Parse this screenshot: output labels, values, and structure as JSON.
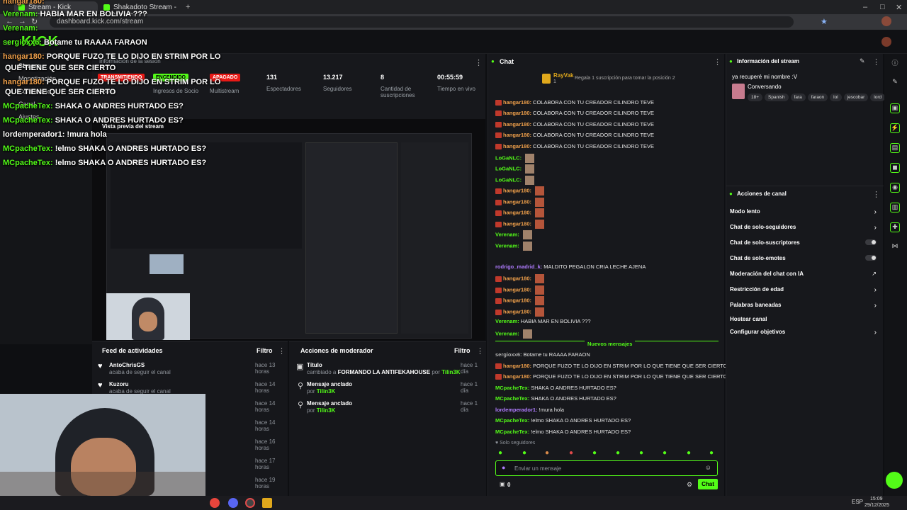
{
  "browser": {
    "tabs": [
      "Stream - Kick Dashboard",
      "Shakadoto Stream - Watch Live"
    ],
    "url": "dashboard.kick.com/stream",
    "clock": "15:09",
    "date": "29/12/2025",
    "lang": "ESP"
  },
  "header": {
    "logo": "KICK"
  },
  "leftnav": {
    "items": [
      "Stream",
      "Monetización",
      "Comunidad",
      "Canal",
      "Ajustes"
    ],
    "info_label": "Información de la sesión"
  },
  "stats": {
    "status_pill": "TRANSMITIENDO",
    "status_label": "Estado",
    "socio_pill": "ENCENDIDO",
    "socio_label": "Ingresos de Socio",
    "multistream_pill": "APAGADO",
    "multistream_label": "Multistream",
    "viewers": "131",
    "viewers_label": "Espectadores",
    "followers": "13.217",
    "followers_label": "Seguidores",
    "subs": "8",
    "subs_label": "Cantidad de suscripciones",
    "uptime": "00:55:59",
    "uptime_label": "Tiempo en vivo"
  },
  "preview": {
    "label": "Vista previa del stream"
  },
  "overlay_chat": [
    {
      "user": "hangar180:",
      "text": "",
      "color": "#f0a04b"
    },
    {
      "user": "Verenam:",
      "text": "HABIA MAR EN BOLIVIA ???",
      "color": "#53fc18"
    },
    {
      "user": "Verenam:",
      "text": "",
      "color": "#53fc18"
    },
    {
      "user": "sergioxx6:",
      "text": "Botame tu RAAAA FARAON",
      "color": "#53fc18"
    },
    {
      "user": "hangar180:",
      "text": "PORQUE FUZO TE LO DIJO EN STRIM POR LO",
      "color": "#f0a04b"
    },
    {
      "user": "",
      "text": "QUE TIENE QUE SER CIERTO",
      "color": "#fff"
    },
    {
      "user": "hangar180:",
      "text": "PORQUE FUZO TE LO DIJO EN STRIM POR LO",
      "color": "#f0a04b"
    },
    {
      "user": "",
      "text": "QUE TIENE QUE SER CIERTO",
      "color": "#fff"
    },
    {
      "user": "MCpacheTex:",
      "text": "SHAKA O ANDRES HURTADO ES?",
      "color": "#53fc18"
    },
    {
      "user": "MCpacheTex:",
      "text": "SHAKA O ANDRES HURTADO ES?",
      "color": "#53fc18"
    },
    {
      "user": "lordemperador1:",
      "text": "!mura hola",
      "color": "#fff"
    },
    {
      "user": "MCpacheTex:",
      "text": "!elmo SHAKA O ANDRES HURTADO ES?",
      "color": "#53fc18"
    },
    {
      "user": "MCpacheTex:",
      "text": "!elmo SHAKA O ANDRES HURTADO ES?",
      "color": "#53fc18"
    }
  ],
  "activity": {
    "title": "Feed de actividades",
    "filter": "Filtro",
    "items": [
      {
        "user": "AntoChrisGS",
        "action": "acaba de seguir el canal",
        "time": "hace 13 horas"
      },
      {
        "user": "Kuzoru",
        "action": "acaba de seguir el canal",
        "time": "hace 14 horas"
      },
      {
        "user": "",
        "action": "",
        "time": "hace 14 horas"
      },
      {
        "user": "",
        "action": "",
        "time": "hace 14 horas"
      },
      {
        "user": "",
        "action": "",
        "time": "hace 16 horas"
      },
      {
        "user": "",
        "action": "",
        "time": "hace 17 horas"
      },
      {
        "user": "",
        "action": "",
        "time": "hace 19 horas"
      }
    ]
  },
  "modactions": {
    "title": "Acciones de moderador",
    "filter": "Filtro",
    "items": [
      {
        "title": "Título",
        "prefix": "cambiado a",
        "detail": "FORMANDO LA ANTIFEKAHOUSE",
        "by": "por",
        "mod": "Tilin3K",
        "time": "hace 1 día"
      },
      {
        "title": "Mensaje anclado",
        "prefix": "",
        "detail": "",
        "by": "por",
        "mod": "Tilin3K",
        "time": "hace 1 día"
      },
      {
        "title": "Mensaje anclado",
        "prefix": "",
        "detail": "",
        "by": "por",
        "mod": "Tilin3K",
        "time": "hace 1 día"
      }
    ]
  },
  "chat": {
    "title": "Chat",
    "gifter": "RayVak",
    "gifter_count": "1",
    "gift_prompt": "Regala 1 suscripción para tomar la posición 2",
    "messages": [
      {
        "user": "hangar180:",
        "text": "COLABORA CON TU CREADOR CILINDRO TEVE",
        "color": "#f0a04b"
      },
      {
        "user": "hangar180:",
        "text": "COLABORA CON TU CREADOR CILINDRO TEVE",
        "color": "#f0a04b"
      },
      {
        "user": "hangar180:",
        "text": "COLABORA CON TU CREADOR CILINDRO TEVE",
        "color": "#f0a04b"
      },
      {
        "user": "hangar180:",
        "text": "COLABORA CON TU CREADOR CILINDRO TEVE",
        "color": "#f0a04b"
      },
      {
        "user": "hangar180:",
        "text": "COLABORA CON TU CREADOR CILINDRO TEVE",
        "color": "#f0a04b"
      },
      {
        "user": "LoGaNLC:",
        "text": "",
        "color": "#53fc18"
      },
      {
        "user": "LoGaNLC:",
        "text": "",
        "color": "#53fc18"
      },
      {
        "user": "LoGaNLC:",
        "text": "",
        "color": "#53fc18"
      },
      {
        "user": "hangar180:",
        "text": "",
        "color": "#f0a04b"
      },
      {
        "user": "hangar180:",
        "text": "",
        "color": "#f0a04b"
      },
      {
        "user": "hangar180:",
        "text": "",
        "color": "#f0a04b"
      },
      {
        "user": "hangar180:",
        "text": "",
        "color": "#f0a04b"
      },
      {
        "user": "Verenam:",
        "text": "",
        "color": "#53fc18"
      },
      {
        "user": "Verenam:",
        "text": "",
        "color": "#53fc18"
      },
      {
        "user": "rodrigo_madrid_k:",
        "text": "MALDITO PEGALON CRIA LECHE AJENA",
        "color": "#b07cff"
      },
      {
        "user": "hangar180:",
        "text": "",
        "color": "#f0a04b"
      },
      {
        "user": "hangar180:",
        "text": "",
        "color": "#f0a04b"
      },
      {
        "user": "hangar180:",
        "text": "",
        "color": "#f0a04b"
      },
      {
        "user": "hangar180:",
        "text": "",
        "color": "#f0a04b"
      },
      {
        "user": "Verenam:",
        "text": "HABIA MAR EN BOLIVIA ???",
        "color": "#53fc18"
      },
      {
        "user": "Verenam:",
        "text": "",
        "color": "#53fc18"
      }
    ],
    "new_messages_label": "Nuevos mensajes",
    "new_messages": [
      {
        "user": "sergioxx6:",
        "text": "Botame tu RAAAA FARAON",
        "color": "#b0b0b0"
      },
      {
        "user": "hangar180:",
        "text": "PORQUE FUZO TE LO DIJO EN STRIM POR LO QUE TIENE QUE SER CIERTO",
        "color": "#f0a04b"
      },
      {
        "user": "hangar180:",
        "text": "PORQUE FUZO TE LO DIJO EN STRIM POR LO QUE TIENE QUE SER CIERTO",
        "color": "#f0a04b"
      },
      {
        "user": "MCpacheTex:",
        "text": "SHAKA O ANDRES HURTADO ES?",
        "color": "#53fc18"
      },
      {
        "user": "MCpacheTex:",
        "text": "SHAKA O ANDRES HURTADO ES?",
        "color": "#53fc18"
      },
      {
        "user": "lordemperador1:",
        "text": "!mura hola",
        "color": "#b07cff"
      },
      {
        "user": "MCpacheTex:",
        "text": "!elmo SHAKA O ANDRES HURTADO ES?",
        "color": "#53fc18"
      },
      {
        "user": "MCpacheTex:",
        "text": "!elmo SHAKA O ANDRES HURTADO ES?",
        "color": "#53fc18"
      }
    ],
    "followers_only": "Solo seguidores",
    "input_placeholder": "Enviar un mensaje",
    "points": "0",
    "send_label": "Chat"
  },
  "streaminfo": {
    "title": "Información del stream",
    "stream_title": "ya recuperé mi nombre :V",
    "category": "Conversando",
    "tags": [
      "18+",
      "Spanish",
      "fara",
      "faraon",
      "lol",
      "jescobar",
      "lord"
    ]
  },
  "channelactions": {
    "title": "Acciones de canal",
    "items": [
      {
        "label": "Modo lento",
        "control": "chevron"
      },
      {
        "label": "Chat de solo-seguidores",
        "control": "chevron"
      },
      {
        "label": "Chat de solo-suscriptores",
        "control": "toggle"
      },
      {
        "label": "Chat de solo-emotes",
        "control": "toggle"
      },
      {
        "label": "Moderación del chat con IA",
        "control": "external"
      },
      {
        "label": "Restricción de edad",
        "control": "chevron"
      },
      {
        "label": "Palabras baneadas",
        "control": "chevron"
      },
      {
        "label": "Hostear canal",
        "control": "none"
      },
      {
        "label": "Configurar objetivos",
        "control": "chevron"
      }
    ]
  },
  "colors": {
    "accent": "#53fc18",
    "live": "#e91916",
    "bg": "#0e0f12",
    "panel": "#17181c"
  }
}
